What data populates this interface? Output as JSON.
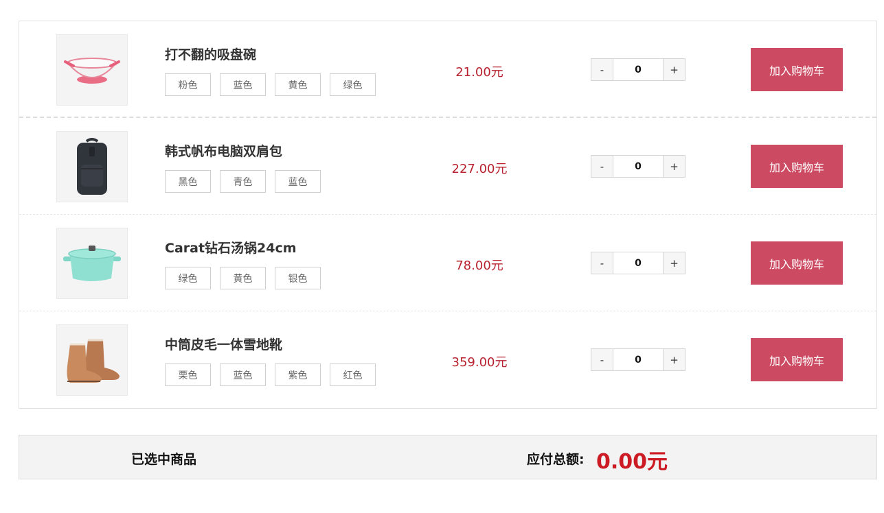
{
  "products": [
    {
      "name": "打不翻的吸盘碗",
      "variants": [
        "粉色",
        "蓝色",
        "黄色",
        "绿色"
      ],
      "price": "21.00元",
      "quantity": "0",
      "image_icon": "bowl-image"
    },
    {
      "name": "韩式帆布电脑双肩包",
      "variants": [
        "黑色",
        "青色",
        "蓝色"
      ],
      "price": "227.00元",
      "quantity": "0",
      "image_icon": "backpack-image"
    },
    {
      "name": "Carat钻石汤锅24cm",
      "variants": [
        "绿色",
        "黄色",
        "银色"
      ],
      "price": "78.00元",
      "quantity": "0",
      "image_icon": "pot-image"
    },
    {
      "name": "中筒皮毛一体雪地靴",
      "variants": [
        "栗色",
        "蓝色",
        "紫色",
        "红色"
      ],
      "price": "359.00元",
      "quantity": "0",
      "image_icon": "boots-image"
    }
  ],
  "controls": {
    "minus": "-",
    "plus": "+",
    "add_to_cart": "加入购物车"
  },
  "summary": {
    "selected_label": "已选中商品",
    "total_label": "应付总额:",
    "total_value": "0.00元"
  },
  "colors": {
    "accent": "#cc4a62",
    "price": "#b8232f",
    "total": "#cc1b24"
  }
}
